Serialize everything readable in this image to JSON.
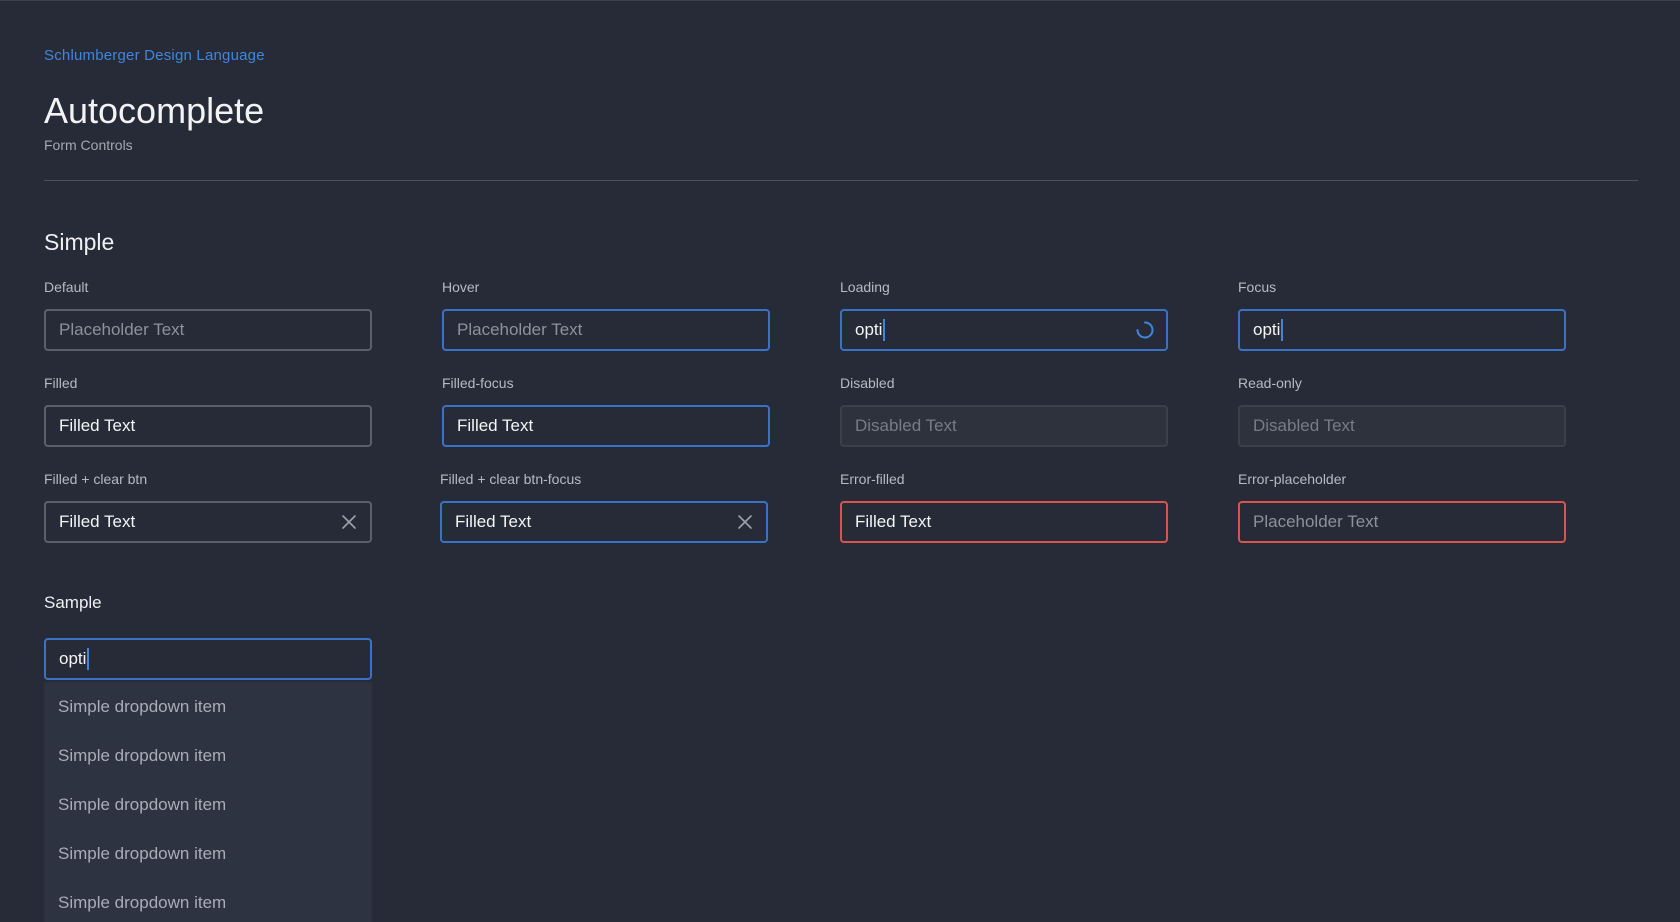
{
  "header": {
    "brand": "Schlumberger Design Language",
    "title": "Autocomplete",
    "subtitle": "Form Controls"
  },
  "simple": {
    "heading": "Simple",
    "cells": {
      "default": {
        "label": "Default",
        "placeholder": "Placeholder Text"
      },
      "hover": {
        "label": "Hover",
        "placeholder": "Placeholder Text"
      },
      "loading": {
        "label": "Loading",
        "value": "opti",
        "icon": "spinner-icon"
      },
      "focus": {
        "label": "Focus",
        "value": "opti"
      },
      "filled": {
        "label": "Filled",
        "value": "Filled Text"
      },
      "filled_focus": {
        "label": "Filled-focus",
        "value": "Filled Text"
      },
      "disabled": {
        "label": "Disabled",
        "value": "Disabled Text"
      },
      "read_only": {
        "label": "Read-only",
        "value": "Disabled Text"
      },
      "filled_clear": {
        "label": "Filled + clear btn",
        "value": "Filled Text",
        "icon": "close-icon"
      },
      "filled_clear_focus": {
        "label": "Filled + clear btn-focus",
        "value": "Filled Text",
        "icon": "close-icon"
      },
      "error_filled": {
        "label": "Error-filled",
        "value": "Filled Text"
      },
      "error_placeholder": {
        "label": "Error-placeholder",
        "placeholder": "Placeholder Text"
      }
    }
  },
  "sample": {
    "heading": "Sample",
    "value": "opti",
    "dropdown_items": [
      "Simple dropdown item",
      "Simple dropdown item",
      "Simple dropdown item",
      "Simple dropdown item",
      "Simple dropdown item"
    ]
  },
  "colors": {
    "background": "#272b37",
    "accent": "#3f86dd",
    "focus_border": "#3a72c6",
    "error": "#d9534f",
    "border": "#5a5f6a"
  }
}
